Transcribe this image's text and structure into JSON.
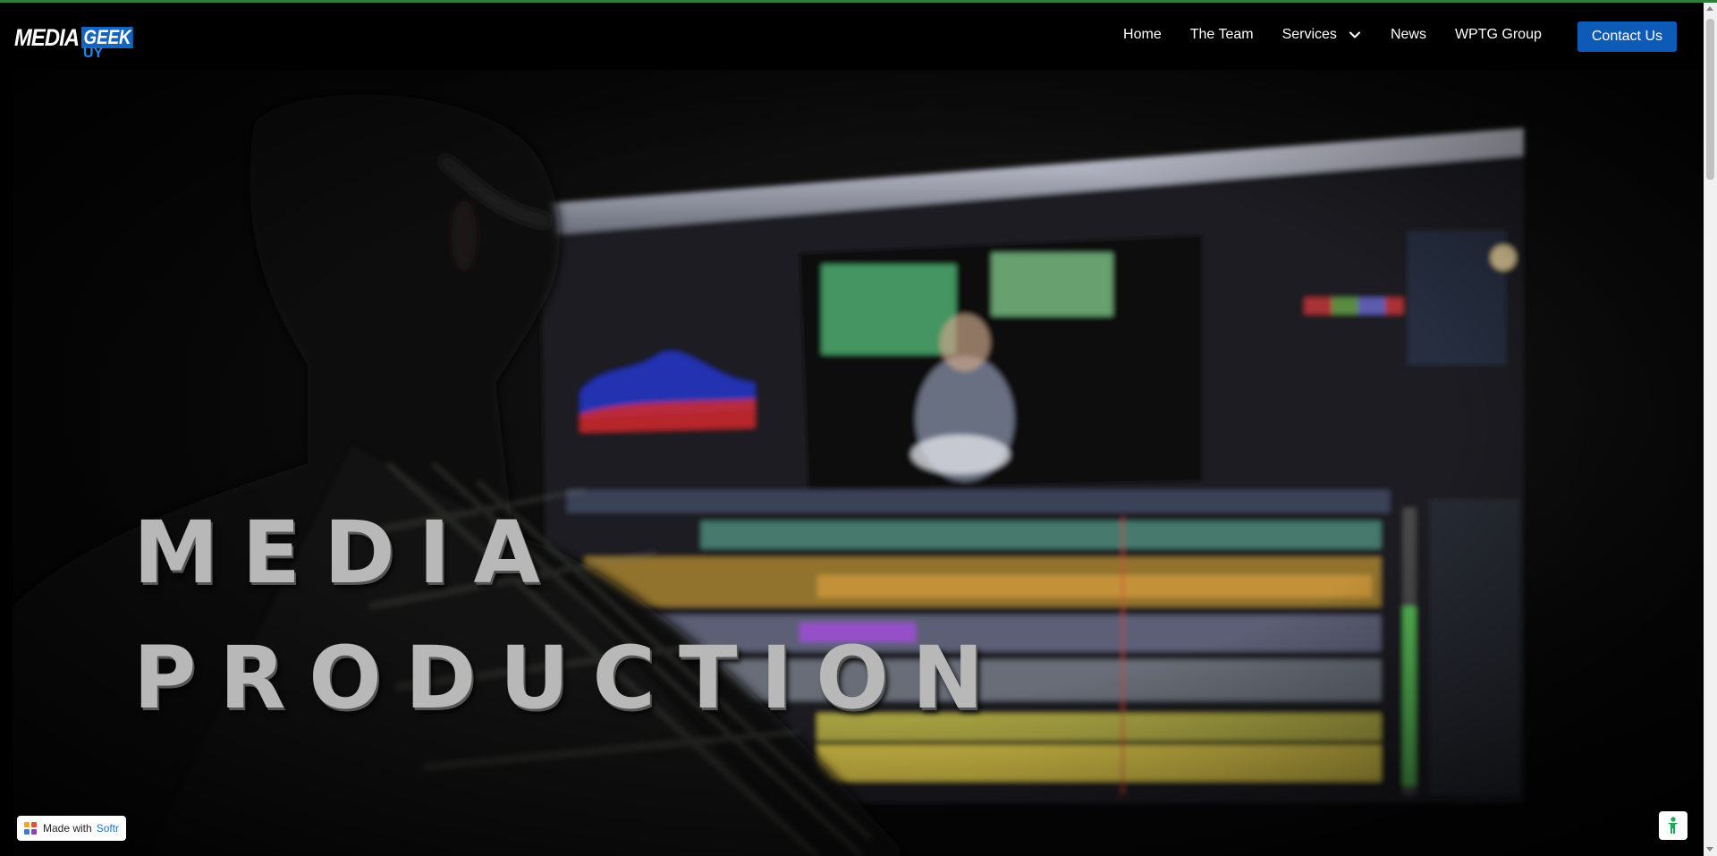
{
  "brand": {
    "logo_text_1": "MEDIA",
    "logo_text_2": "GEEK",
    "logo_text_3": "UY",
    "logo_accent_color": "#1565c0"
  },
  "nav": {
    "items": [
      {
        "label": "Home"
      },
      {
        "label": "The Team"
      },
      {
        "label": "Services",
        "has_dropdown": true
      },
      {
        "label": "News"
      },
      {
        "label": "WPTG Group"
      }
    ],
    "contact_label": "Contact Us",
    "contact_color": "#0d5bb6"
  },
  "hero": {
    "line1": "MEDIA",
    "line2": "PRODUCTION",
    "background_description_icon": "video-editing-scene"
  },
  "badge": {
    "made_with": "Made with",
    "brand": "Softr"
  },
  "corner_button_icon": "accessibility-icon"
}
